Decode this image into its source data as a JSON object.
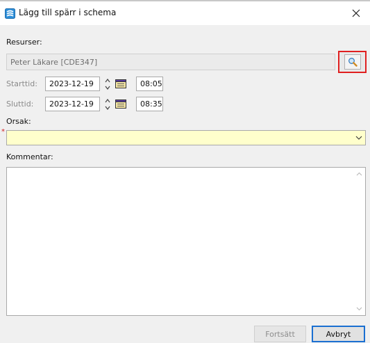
{
  "window": {
    "title": "Lägg till spärr i schema"
  },
  "resources": {
    "label": "Resurser:",
    "value": "Peter Läkare [CDE347]"
  },
  "start": {
    "label": "Starttid:",
    "date": "2023-12-19",
    "time": "08:05"
  },
  "end": {
    "label": "Sluttid:",
    "date": "2023-12-19",
    "time": "08:35"
  },
  "reason": {
    "label": "Orsak:",
    "required_marker": "*",
    "value": ""
  },
  "comment": {
    "label": "Kommentar:",
    "value": ""
  },
  "buttons": {
    "continue": "Fortsätt",
    "cancel": "Avbryt"
  },
  "icons": [
    "app-icon",
    "close-icon",
    "search-icon",
    "spinner-icon",
    "calendar-icon",
    "chevron-down-icon",
    "scroll-up-icon",
    "scroll-down-icon"
  ],
  "colors": {
    "highlight_border": "#e02020",
    "required_field_bg": "#ffffcc",
    "primary_button_border": "#1a6fd1"
  }
}
